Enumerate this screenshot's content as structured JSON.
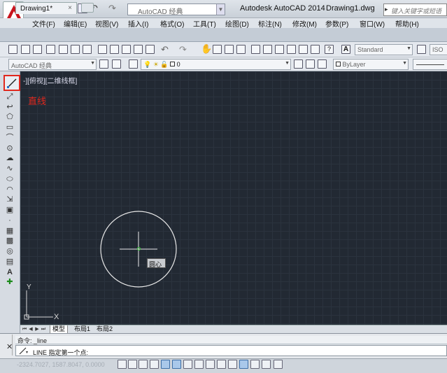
{
  "titlebar": {
    "workspace": "AutoCAD 经典",
    "app_title": "Autodesk AutoCAD 2014",
    "doc_title": "Drawing1.dwg",
    "search_placeholder": "键入关键字或短语"
  },
  "menu": [
    "文件(F)",
    "编辑(E)",
    "视图(V)",
    "插入(I)",
    "格式(O)",
    "工具(T)",
    "绘图(D)",
    "标注(N)",
    "修改(M)",
    "参数(P)",
    "窗口(W)",
    "帮助(H)"
  ],
  "tabs": {
    "document": "Drawing1*",
    "close": "×"
  },
  "toolbar": {
    "text_style": "Standard",
    "text_style_cut": "ISO",
    "workspace2": "AutoCAD 经典",
    "layer_value": "0",
    "color_value": "ByLayer"
  },
  "viewport": {
    "view_label": "-][俯视][二维线框]",
    "tool_tip": "直线",
    "osnap_tip": "圆心",
    "ucs_y": "Y",
    "ucs_x": "X"
  },
  "layout_tabs": [
    "模型",
    "布局1",
    "布局2"
  ],
  "command": {
    "history": "命令: _line",
    "prompt": "LINE 指定第一个点:"
  },
  "status": {
    "coords": "-2324.7027, 1587.8047, 0.0000"
  },
  "colors": {
    "canvas_bg": "#222933",
    "highlight": "#e0281e",
    "app_red": "#c8141e"
  }
}
